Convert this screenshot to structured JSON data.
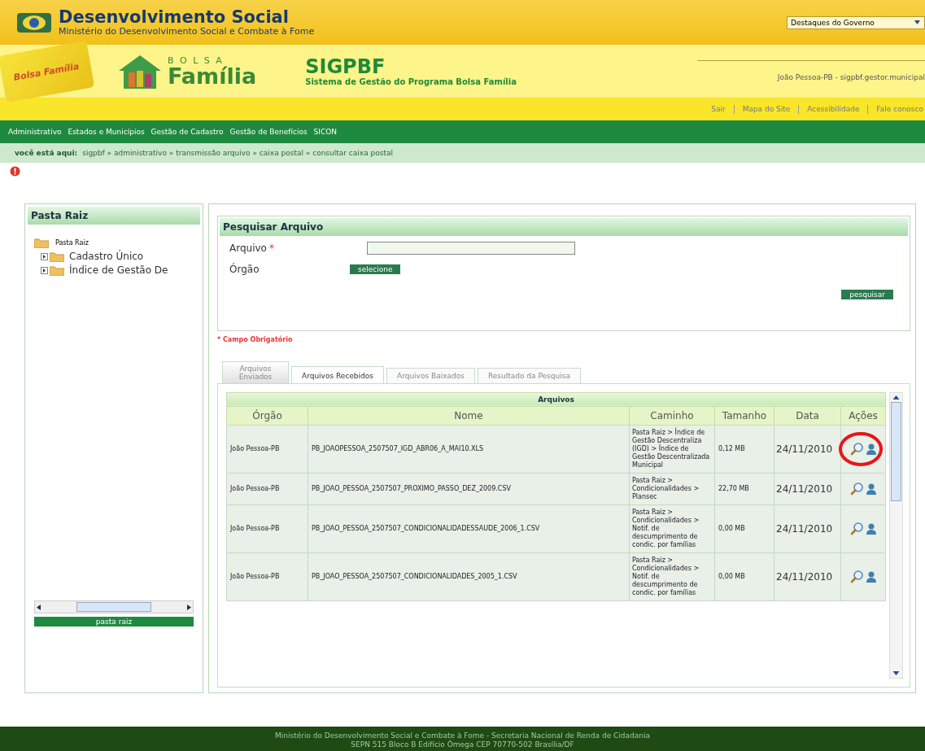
{
  "header": {
    "title": "Desenvolvimento Social",
    "subtitle": "Ministério do Desenvolvimento Social e Combate à Fome",
    "gov_select": "Destaques do Governo",
    "card_text": "Bolsa Família",
    "logo_top": "B O L S A",
    "logo_main": "Família",
    "system_name": "SIGPBF",
    "system_subtitle": "Sistema de Gestão do Programa Bolsa Família",
    "user": "João Pessoa-PB - sigpbf.gestor.municipal",
    "links": [
      "Sair",
      "Mapa do Site",
      "Acessibilidade",
      "Fale conosco"
    ]
  },
  "nav": [
    "Administrativo",
    "Estados e Municípios",
    "Gestão de Cadastro",
    "Gestão de Benefícios",
    "SICON"
  ],
  "breadcrumb": {
    "label": "você está aqui:",
    "path": "sigpbf » administrativo » transmissão arquivo » caixa postal » consultar caixa postal"
  },
  "sidebar": {
    "title": "Pasta Raiz",
    "tree": [
      {
        "label": "Pasta Raiz",
        "children": [
          {
            "label": "Cadastro Único"
          },
          {
            "label": "Índice de Gestão De"
          }
        ]
      }
    ],
    "button": "pasta raiz"
  },
  "search": {
    "title": "Pesquisar Arquivo",
    "file_label": "Arquivo",
    "required_mark": "*",
    "organ_label": "Órgão",
    "select_button": "selecione",
    "search_button": "pesquisar",
    "required_note": "* Campo Obrigatório"
  },
  "tabs": [
    {
      "label": "Arquivos Enviados",
      "selected": false
    },
    {
      "label": "Arquivos Recebidos",
      "selected": true
    },
    {
      "label": "Arquivos Baixados",
      "selected": false
    },
    {
      "label": "Resultado da Pesquisa",
      "selected": false
    }
  ],
  "table": {
    "caption": "Arquivos",
    "columns": [
      "Órgão",
      "Nome",
      "Caminho",
      "Tamanho",
      "Data",
      "Ações"
    ],
    "rows": [
      {
        "orgao": "João Pessoa-PB",
        "nome": "PB_JOAOPESSOA_2507507_IGD_ABR06_A_MAI10.XLS",
        "caminho": "Pasta Raiz > Índice de Gestão Descentraliza (IGD) > Índice de Gestão Descentralizada Municipal",
        "tamanho": "0,12 MB",
        "data": "24/11/2010",
        "highlighted": true
      },
      {
        "orgao": "João Pessoa-PB",
        "nome": "PB_JOAO_PESSOA_2507507_PROXIMO_PASSO_DEZ_2009.CSV",
        "caminho": "Pasta Raiz > Condicionalidades > Plansec",
        "tamanho": "22,70 MB",
        "data": "24/11/2010",
        "highlighted": false
      },
      {
        "orgao": "João Pessoa-PB",
        "nome": "PB_JOAO_PESSOA_2507507_CONDICIONALIDADESSAUDE_2006_1.CSV",
        "caminho": "Pasta Raiz > Condicionalidades > Notif. de descumprimento de condic. por famílias",
        "tamanho": "0,00 MB",
        "data": "24/11/2010",
        "highlighted": false
      },
      {
        "orgao": "João Pessoa-PB",
        "nome": "PB_JOAO_PESSOA_2507507_CONDICIONALIDADES_2005_1.CSV",
        "caminho": "Pasta Raiz > Condicionalidades > Notif. de descumprimento de condic. por famílias",
        "tamanho": "0,00 MB",
        "data": "24/11/2010",
        "highlighted": false
      }
    ]
  },
  "footer": [
    "Ministério do Desenvolvimento Social e Combate à Fome - Secretaria Nacional de Renda de Cidadania",
    "SEPN 515 Bloco B Edifício Ômega CEP 70770-502 Brasília/DF"
  ]
}
